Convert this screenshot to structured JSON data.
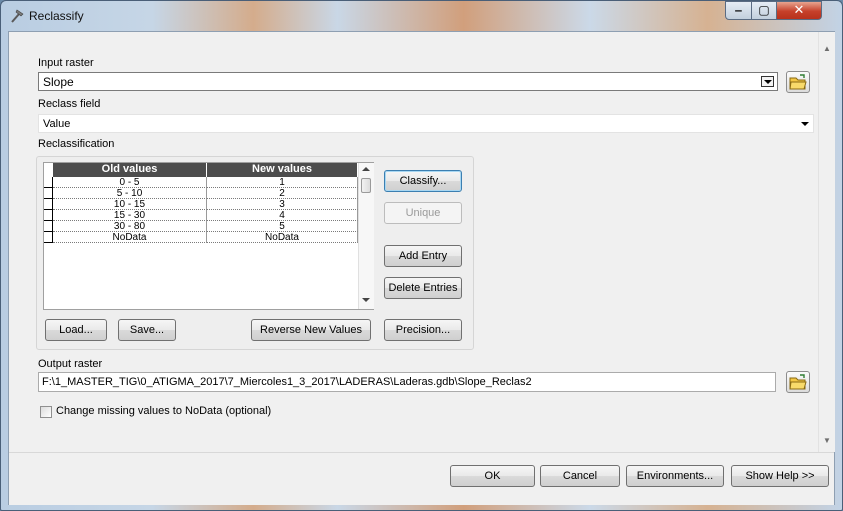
{
  "window": {
    "title": "Reclassify"
  },
  "input_raster": {
    "label": "Input raster",
    "value": "Slope"
  },
  "reclass_field": {
    "label": "Reclass field",
    "value": "Value"
  },
  "reclassification": {
    "label": "Reclassification",
    "columns": [
      "Old values",
      "New values"
    ],
    "rows": [
      [
        "0 - 5",
        "1"
      ],
      [
        "5 - 10",
        "2"
      ],
      [
        "10 - 15",
        "3"
      ],
      [
        "15 - 30",
        "4"
      ],
      [
        "30 - 80",
        "5"
      ],
      [
        "NoData",
        "NoData"
      ]
    ],
    "buttons": {
      "classify": "Classify...",
      "unique": "Unique",
      "add_entry": "Add Entry",
      "delete_entries": "Delete Entries",
      "load": "Load...",
      "save": "Save...",
      "reverse": "Reverse New Values",
      "precision": "Precision..."
    }
  },
  "output_raster": {
    "label": "Output raster",
    "value": "F:\\1_MASTER_TIG\\0_ATIGMA_2017\\7_Miercoles1_3_2017\\LADERAS\\Laderas.gdb\\Slope_Reclas2"
  },
  "missing_values": {
    "label": "Change missing values to NoData (optional)",
    "checked": false
  },
  "footer": {
    "ok": "OK",
    "cancel": "Cancel",
    "environments": "Environments...",
    "show_help": "Show Help >>"
  }
}
